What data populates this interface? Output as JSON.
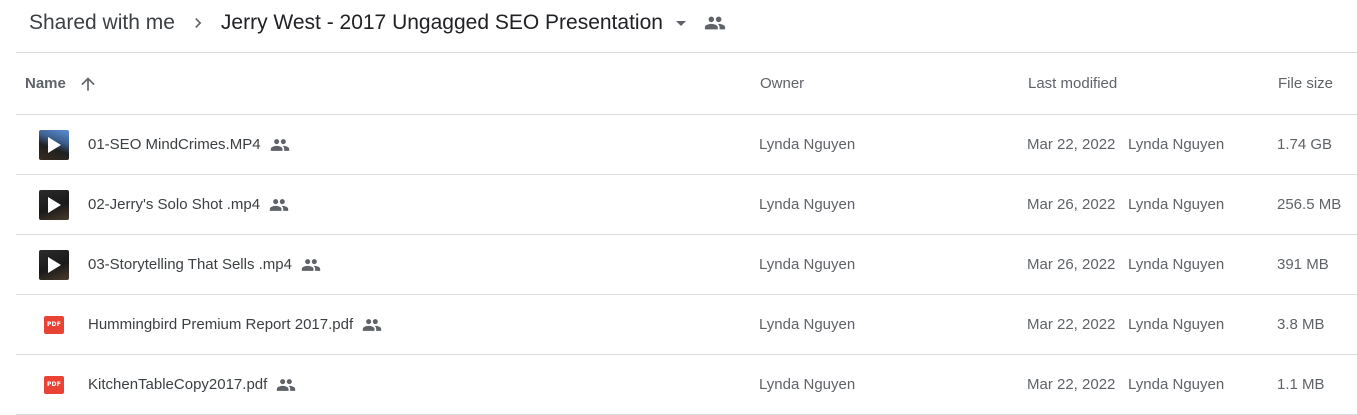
{
  "breadcrumb": {
    "root": "Shared with me",
    "current": "Jerry West - 2017 Ungagged SEO Presentation"
  },
  "table": {
    "headers": {
      "name": "Name",
      "owner": "Owner",
      "last_modified": "Last modified",
      "file_size": "File size"
    },
    "sort": {
      "column": "name",
      "direction": "ascending"
    },
    "rows": [
      {
        "type": "video",
        "name": "01-SEO MindCrimes.MP4",
        "owner": "Lynda Nguyen",
        "modified_date": "Mar 22, 2022",
        "modified_by": "Lynda Nguyen",
        "size": "1.74 GB"
      },
      {
        "type": "video",
        "name": "02-Jerry's Solo Shot .mp4",
        "owner": "Lynda Nguyen",
        "modified_date": "Mar 26, 2022",
        "modified_by": "Lynda Nguyen",
        "size": "256.5 MB"
      },
      {
        "type": "video",
        "name": "03-Storytelling That Sells .mp4",
        "owner": "Lynda Nguyen",
        "modified_date": "Mar 26, 2022",
        "modified_by": "Lynda Nguyen",
        "size": "391 MB"
      },
      {
        "type": "pdf",
        "name": "Hummingbird Premium Report 2017.pdf",
        "owner": "Lynda Nguyen",
        "modified_date": "Mar 22, 2022",
        "modified_by": "Lynda Nguyen",
        "size": "3.8 MB"
      },
      {
        "type": "pdf",
        "name": "KitchenTableCopy2017.pdf",
        "owner": "Lynda Nguyen",
        "modified_date": "Mar 22, 2022",
        "modified_by": "Lynda Nguyen",
        "size": "1.1 MB"
      }
    ]
  },
  "icons": {
    "pdf_label": "PDF",
    "breadcrumb_separator": "chevron-right-icon",
    "folder_menu": "dropdown-caret-icon",
    "shared": "people-icon",
    "sort": "arrow-up-icon",
    "video": "video-play-icon",
    "pdf": "pdf-file-icon"
  },
  "colors": {
    "text_primary": "#3c4043",
    "text_secondary": "#5f6368",
    "divider": "#dadce0",
    "pdf_red": "#ea4335"
  }
}
